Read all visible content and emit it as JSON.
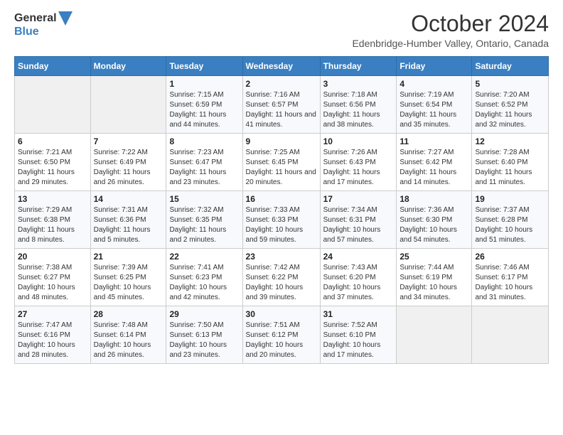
{
  "header": {
    "logo_line1": "General",
    "logo_line2": "Blue",
    "title": "October 2024",
    "subtitle": "Edenbridge-Humber Valley, Ontario, Canada"
  },
  "days_of_week": [
    "Sunday",
    "Monday",
    "Tuesday",
    "Wednesday",
    "Thursday",
    "Friday",
    "Saturday"
  ],
  "weeks": [
    [
      {
        "day": "",
        "detail": ""
      },
      {
        "day": "",
        "detail": ""
      },
      {
        "day": "1",
        "detail": "Sunrise: 7:15 AM\nSunset: 6:59 PM\nDaylight: 11 hours and 44 minutes."
      },
      {
        "day": "2",
        "detail": "Sunrise: 7:16 AM\nSunset: 6:57 PM\nDaylight: 11 hours and 41 minutes."
      },
      {
        "day": "3",
        "detail": "Sunrise: 7:18 AM\nSunset: 6:56 PM\nDaylight: 11 hours and 38 minutes."
      },
      {
        "day": "4",
        "detail": "Sunrise: 7:19 AM\nSunset: 6:54 PM\nDaylight: 11 hours and 35 minutes."
      },
      {
        "day": "5",
        "detail": "Sunrise: 7:20 AM\nSunset: 6:52 PM\nDaylight: 11 hours and 32 minutes."
      }
    ],
    [
      {
        "day": "6",
        "detail": "Sunrise: 7:21 AM\nSunset: 6:50 PM\nDaylight: 11 hours and 29 minutes."
      },
      {
        "day": "7",
        "detail": "Sunrise: 7:22 AM\nSunset: 6:49 PM\nDaylight: 11 hours and 26 minutes."
      },
      {
        "day": "8",
        "detail": "Sunrise: 7:23 AM\nSunset: 6:47 PM\nDaylight: 11 hours and 23 minutes."
      },
      {
        "day": "9",
        "detail": "Sunrise: 7:25 AM\nSunset: 6:45 PM\nDaylight: 11 hours and 20 minutes."
      },
      {
        "day": "10",
        "detail": "Sunrise: 7:26 AM\nSunset: 6:43 PM\nDaylight: 11 hours and 17 minutes."
      },
      {
        "day": "11",
        "detail": "Sunrise: 7:27 AM\nSunset: 6:42 PM\nDaylight: 11 hours and 14 minutes."
      },
      {
        "day": "12",
        "detail": "Sunrise: 7:28 AM\nSunset: 6:40 PM\nDaylight: 11 hours and 11 minutes."
      }
    ],
    [
      {
        "day": "13",
        "detail": "Sunrise: 7:29 AM\nSunset: 6:38 PM\nDaylight: 11 hours and 8 minutes."
      },
      {
        "day": "14",
        "detail": "Sunrise: 7:31 AM\nSunset: 6:36 PM\nDaylight: 11 hours and 5 minutes."
      },
      {
        "day": "15",
        "detail": "Sunrise: 7:32 AM\nSunset: 6:35 PM\nDaylight: 11 hours and 2 minutes."
      },
      {
        "day": "16",
        "detail": "Sunrise: 7:33 AM\nSunset: 6:33 PM\nDaylight: 10 hours and 59 minutes."
      },
      {
        "day": "17",
        "detail": "Sunrise: 7:34 AM\nSunset: 6:31 PM\nDaylight: 10 hours and 57 minutes."
      },
      {
        "day": "18",
        "detail": "Sunrise: 7:36 AM\nSunset: 6:30 PM\nDaylight: 10 hours and 54 minutes."
      },
      {
        "day": "19",
        "detail": "Sunrise: 7:37 AM\nSunset: 6:28 PM\nDaylight: 10 hours and 51 minutes."
      }
    ],
    [
      {
        "day": "20",
        "detail": "Sunrise: 7:38 AM\nSunset: 6:27 PM\nDaylight: 10 hours and 48 minutes."
      },
      {
        "day": "21",
        "detail": "Sunrise: 7:39 AM\nSunset: 6:25 PM\nDaylight: 10 hours and 45 minutes."
      },
      {
        "day": "22",
        "detail": "Sunrise: 7:41 AM\nSunset: 6:23 PM\nDaylight: 10 hours and 42 minutes."
      },
      {
        "day": "23",
        "detail": "Sunrise: 7:42 AM\nSunset: 6:22 PM\nDaylight: 10 hours and 39 minutes."
      },
      {
        "day": "24",
        "detail": "Sunrise: 7:43 AM\nSunset: 6:20 PM\nDaylight: 10 hours and 37 minutes."
      },
      {
        "day": "25",
        "detail": "Sunrise: 7:44 AM\nSunset: 6:19 PM\nDaylight: 10 hours and 34 minutes."
      },
      {
        "day": "26",
        "detail": "Sunrise: 7:46 AM\nSunset: 6:17 PM\nDaylight: 10 hours and 31 minutes."
      }
    ],
    [
      {
        "day": "27",
        "detail": "Sunrise: 7:47 AM\nSunset: 6:16 PM\nDaylight: 10 hours and 28 minutes."
      },
      {
        "day": "28",
        "detail": "Sunrise: 7:48 AM\nSunset: 6:14 PM\nDaylight: 10 hours and 26 minutes."
      },
      {
        "day": "29",
        "detail": "Sunrise: 7:50 AM\nSunset: 6:13 PM\nDaylight: 10 hours and 23 minutes."
      },
      {
        "day": "30",
        "detail": "Sunrise: 7:51 AM\nSunset: 6:12 PM\nDaylight: 10 hours and 20 minutes."
      },
      {
        "day": "31",
        "detail": "Sunrise: 7:52 AM\nSunset: 6:10 PM\nDaylight: 10 hours and 17 minutes."
      },
      {
        "day": "",
        "detail": ""
      },
      {
        "day": "",
        "detail": ""
      }
    ]
  ],
  "colors": {
    "header_bg": "#3a7fc1",
    "logo_blue": "#2b6cb0"
  }
}
